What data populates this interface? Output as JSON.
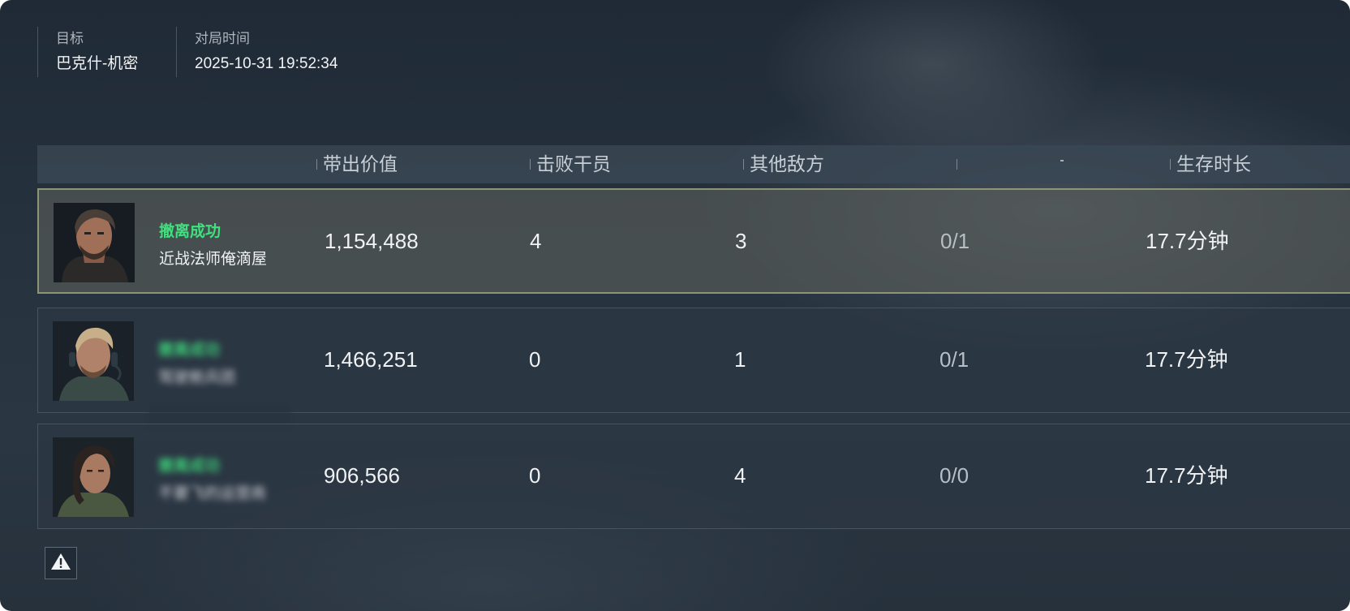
{
  "header": {
    "target_label": "目标",
    "target_value": "巴克什-机密",
    "time_label": "对局时间",
    "time_value": "2025-10-31 19:52:34"
  },
  "table": {
    "columns": [
      "带出价值",
      "击败干员",
      "其他敌方",
      "",
      "生存时长"
    ],
    "rows": [
      {
        "status": "撤离成功",
        "name": "近战法师俺滴屋",
        "value": "1,154,488",
        "kills": "4",
        "other": "3",
        "ratio": "0/1",
        "time": "17.7分钟",
        "selected": true,
        "blurred": false
      },
      {
        "status": "撤离成功",
        "name": "驾驶舱兵团",
        "value": "1,466,251",
        "kills": "0",
        "other": "1",
        "ratio": "0/1",
        "time": "17.7分钟",
        "selected": false,
        "blurred": true
      },
      {
        "status": "撤离成功",
        "name": "不要飞的运营商",
        "value": "906,566",
        "kills": "0",
        "other": "4",
        "ratio": "0/0",
        "time": "17.7分钟",
        "selected": false,
        "blurred": true
      }
    ]
  },
  "colors": {
    "status_green": "#3fe07e",
    "selected_border": "#8e9476"
  },
  "icons": {
    "warning": "warning-icon"
  }
}
